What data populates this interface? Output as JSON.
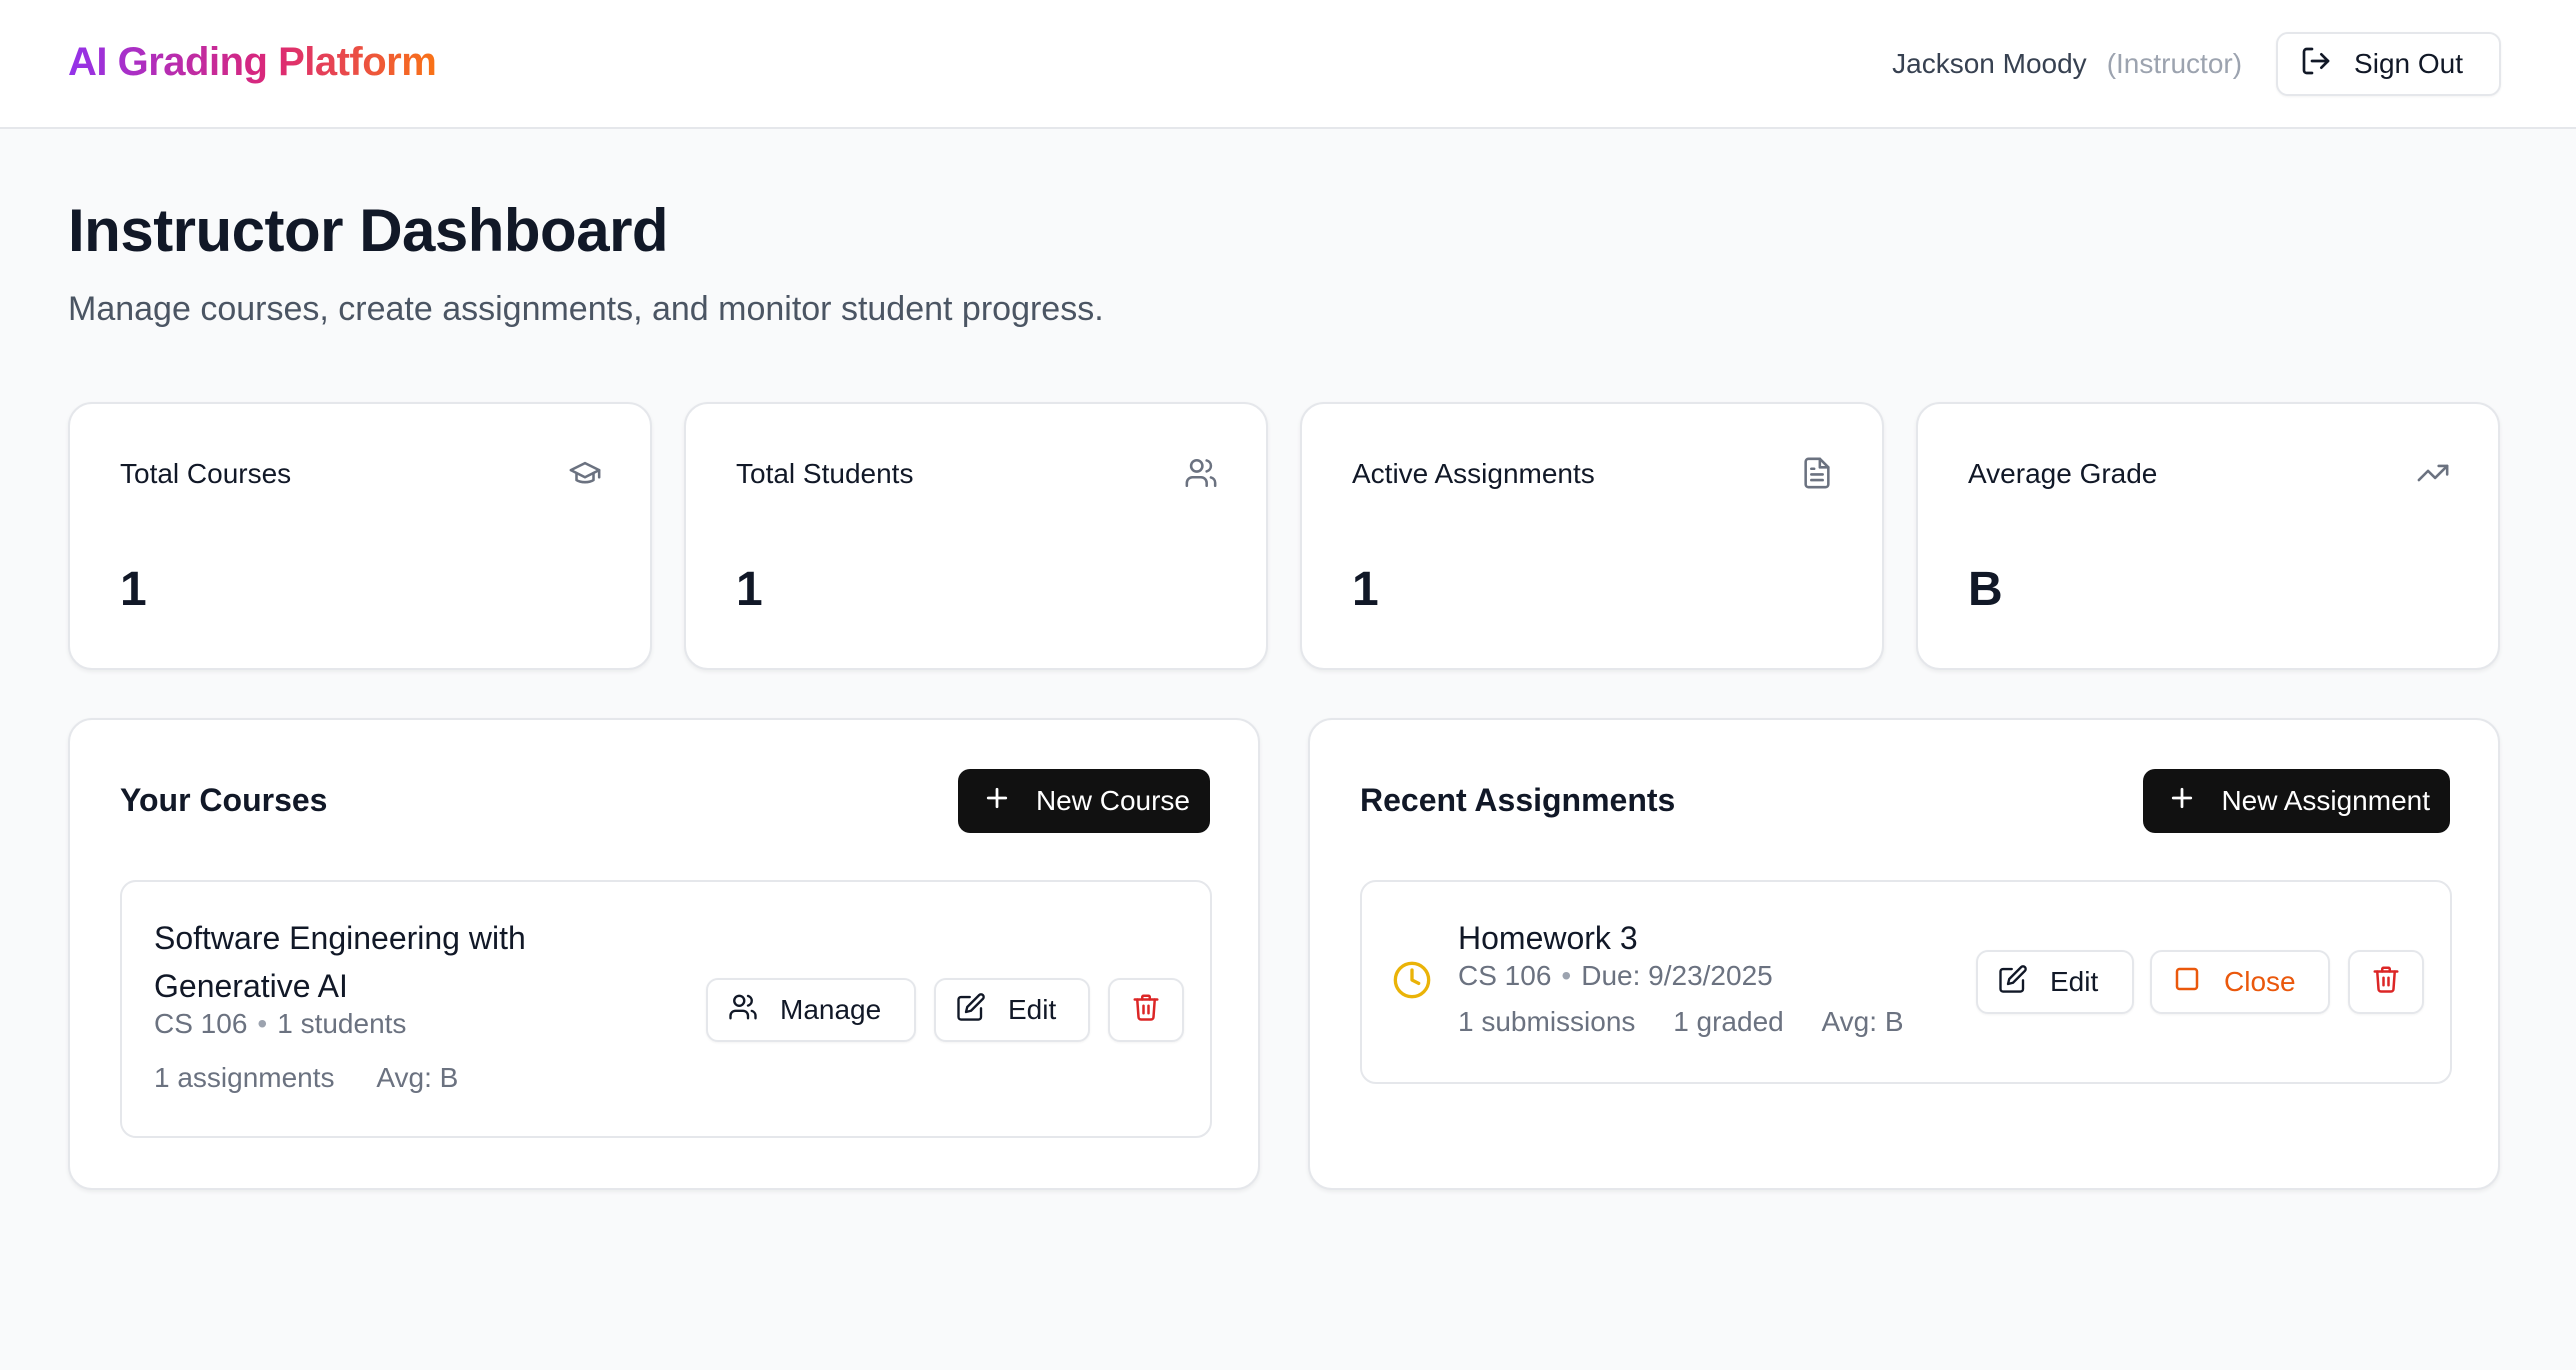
{
  "header": {
    "brand": "AI Grading Platform",
    "user_name": "Jackson Moody",
    "user_role": "(Instructor)",
    "sign_out_label": "Sign Out",
    "sign_out_icon": "log-out-icon"
  },
  "page": {
    "title": "Instructor Dashboard",
    "subtitle": "Manage courses, create assignments, and monitor student progress."
  },
  "stats": [
    {
      "label": "Total Courses",
      "value": "1",
      "icon": "graduation-cap-icon"
    },
    {
      "label": "Total Students",
      "value": "1",
      "icon": "users-icon"
    },
    {
      "label": "Active Assignments",
      "value": "1",
      "icon": "file-text-icon"
    },
    {
      "label": "Average Grade",
      "value": "B",
      "icon": "trending-up-icon"
    }
  ],
  "courses": {
    "title": "Your Courses",
    "new_button": "New Course",
    "items": [
      {
        "title_line1": "Software Engineering with",
        "title_line2": "Generative AI",
        "code": "CS 106",
        "students": "1 students",
        "assignments": "1 assignments",
        "avg": "Avg: B",
        "manage_label": "Manage",
        "edit_label": "Edit"
      }
    ]
  },
  "assignments": {
    "title": "Recent Assignments",
    "new_button": "New Assignment",
    "items": [
      {
        "title": "Homework 3",
        "course": "CS 106",
        "due": "Due: 9/23/2025",
        "submissions": "1 submissions",
        "graded": "1 graded",
        "avg": "Avg: B",
        "status_icon": "clock-icon",
        "edit_label": "Edit",
        "close_label": "Close"
      }
    ]
  },
  "colors": {
    "brand_gradient": [
      "#9333ea",
      "#db2777",
      "#f97316"
    ],
    "danger": "#dc2626",
    "warning": "#eab308",
    "close_accent": "#ea580c",
    "primary_button": "#111111"
  }
}
